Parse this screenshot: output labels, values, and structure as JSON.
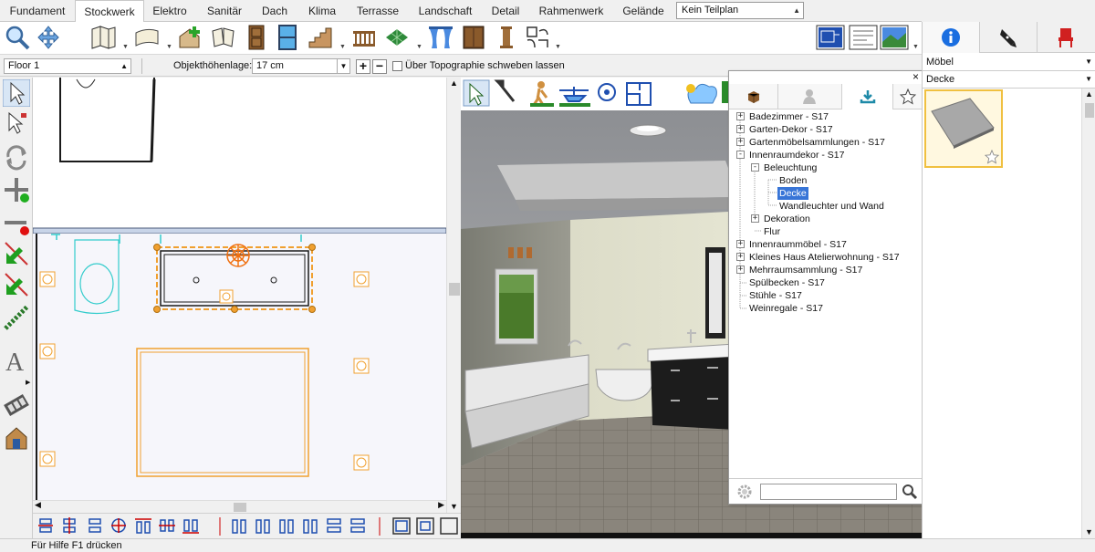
{
  "tabs": [
    {
      "label": "Fundament",
      "active": false
    },
    {
      "label": "Stockwerk",
      "active": true
    },
    {
      "label": "Elektro",
      "active": false
    },
    {
      "label": "Sanitär",
      "active": false
    },
    {
      "label": "Dach",
      "active": false
    },
    {
      "label": "Klima",
      "active": false
    },
    {
      "label": "Terrasse",
      "active": false
    },
    {
      "label": "Landschaft",
      "active": false
    },
    {
      "label": "Detail",
      "active": false
    },
    {
      "label": "Rahmenwerk",
      "active": false
    },
    {
      "label": "Gelände",
      "active": false
    }
  ],
  "plan_selector": {
    "value": "Kein Teilplan"
  },
  "options": {
    "floor_value": "Floor 1",
    "height_label": "Objekthöhenlage:",
    "height_value": "17 cm",
    "topo_label": "Über Topographie schweben lassen",
    "topo_checked": false
  },
  "library": {
    "search_placeholder": "",
    "tree": [
      {
        "label": "Badezimmer - S17",
        "depth": 0,
        "expander": "+"
      },
      {
        "label": "Garten-Dekor - S17",
        "depth": 0,
        "expander": "+"
      },
      {
        "label": "Gartenmöbelsammlungen - S17",
        "depth": 0,
        "expander": "+"
      },
      {
        "label": "Innenraumdekor - S17",
        "depth": 0,
        "expander": "-"
      },
      {
        "label": "Beleuchtung",
        "depth": 1,
        "expander": "-"
      },
      {
        "label": "Boden",
        "depth": 2,
        "expander": ""
      },
      {
        "label": "Decke",
        "depth": 2,
        "expander": "",
        "selected": true
      },
      {
        "label": "Wandleuchter und Wand",
        "depth": 2,
        "expander": ""
      },
      {
        "label": "Dekoration",
        "depth": 1,
        "expander": "+"
      },
      {
        "label": "Flur",
        "depth": 1,
        "expander": ""
      },
      {
        "label": "Innenraummöbel - S17",
        "depth": 0,
        "expander": "+"
      },
      {
        "label": "Kleines Haus Atelierwohnung - S17",
        "depth": 0,
        "expander": "+"
      },
      {
        "label": "Mehrraumsammlung - S17",
        "depth": 0,
        "expander": "+"
      },
      {
        "label": "Spülbecken - S17",
        "depth": 0,
        "expander": ""
      },
      {
        "label": "Stühle - S17",
        "depth": 0,
        "expander": ""
      },
      {
        "label": "Weinregale - S17",
        "depth": 0,
        "expander": ""
      }
    ]
  },
  "right_panel": {
    "category": "Möbel",
    "subcategory": "Decke"
  },
  "status": {
    "text": "Für Hilfe F1 drücken"
  },
  "colors": {
    "selection": "#3875d7",
    "accent_orange": "#f0a030",
    "plan_wall": "#1a1a1a"
  }
}
